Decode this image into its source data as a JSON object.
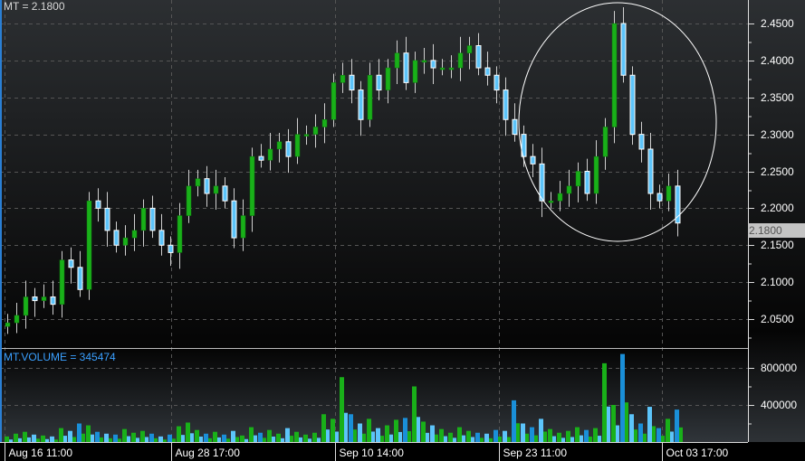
{
  "header": {
    "price_label": "MT = 2.1800",
    "volume_label": "MT.VOLUME = 345474"
  },
  "colors": {
    "up": "#19b019",
    "down": "#5cc4fa",
    "down_dark": "#1a8fd8",
    "grid": "#555555",
    "label_blue": "#3aa0ff",
    "circle": "#ffffff"
  },
  "chart_data": {
    "type": "candlestick",
    "symbol": "MT",
    "last_price": "2.1800",
    "price_axis": {
      "ylim": [
        2.02,
        2.47
      ],
      "ticks": [
        "2.0500",
        "2.1000",
        "2.1500",
        "2.2000",
        "2.2500",
        "2.3000",
        "2.3500",
        "2.4000",
        "2.4500"
      ],
      "tick_values": [
        2.05,
        2.1,
        2.15,
        2.2,
        2.25,
        2.3,
        2.35,
        2.4,
        2.45
      ]
    },
    "volume_axis": {
      "ylim": [
        0,
        1000000
      ],
      "ticks": [
        "400000",
        "800000"
      ],
      "tick_values": [
        400000,
        800000
      ]
    },
    "x_ticks": [
      "Aug 16 11:00",
      "Aug 28 17:00",
      "Sep 10 14:00",
      "Sep 23 11:00",
      "Oct 03 17:00"
    ],
    "x_tick_index": [
      0,
      18.4,
      36.5,
      54.6,
      72.6
    ],
    "open_first": 2.04,
    "closes": [
      2.045,
      2.055,
      2.08,
      2.075,
      2.08,
      2.07,
      2.13,
      2.12,
      2.09,
      2.21,
      2.2,
      2.17,
      2.15,
      2.16,
      2.17,
      2.2,
      2.17,
      2.15,
      2.14,
      2.19,
      2.23,
      2.24,
      2.22,
      2.23,
      2.21,
      2.16,
      2.19,
      2.27,
      2.265,
      2.28,
      2.29,
      2.27,
      2.3,
      2.3,
      2.31,
      2.32,
      2.37,
      2.38,
      2.36,
      2.32,
      2.38,
      2.36,
      2.39,
      2.41,
      2.37,
      2.4,
      2.4,
      2.39,
      2.39,
      2.39,
      2.41,
      2.42,
      2.39,
      2.38,
      2.36,
      2.32,
      2.3,
      2.27,
      2.26,
      2.21,
      2.21,
      2.22,
      2.23,
      2.25,
      2.22,
      2.27,
      2.31,
      2.45,
      2.38,
      2.3,
      2.28,
      2.22,
      2.21,
      2.23,
      2.18
    ],
    "volumes": [
      60000,
      90000,
      110000,
      80000,
      70000,
      60000,
      150000,
      120000,
      200000,
      180000,
      110000,
      90000,
      80000,
      140000,
      100000,
      120000,
      90000,
      60000,
      80000,
      170000,
      210000,
      130000,
      90000,
      110000,
      80000,
      120000,
      70000,
      160000,
      100000,
      130000,
      90000,
      150000,
      110000,
      80000,
      100000,
      300000,
      250000,
      700000,
      300000,
      200000,
      250000,
      150000,
      180000,
      240000,
      260000,
      600000,
      220000,
      180000,
      140000,
      100000,
      160000,
      120000,
      100000,
      90000,
      130000,
      120000,
      450000,
      200000,
      160000,
      250000,
      140000,
      100000,
      120000,
      160000,
      130000,
      150000,
      850000,
      400000,
      950000,
      300000,
      200000,
      380000,
      150000,
      250000,
      350000
    ],
    "annotation": {
      "type": "ellipse",
      "around": "late September spike"
    }
  }
}
